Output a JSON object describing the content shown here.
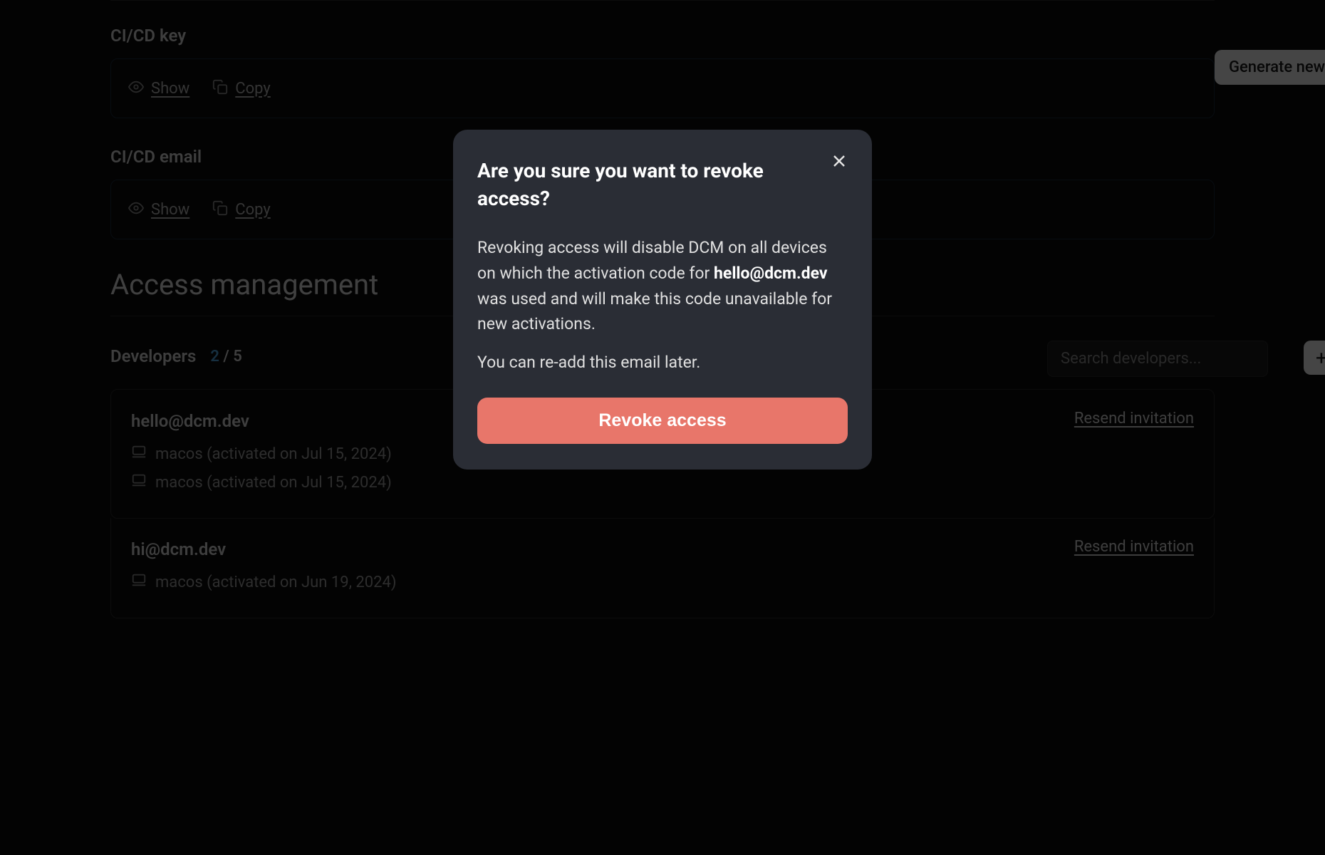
{
  "cicd_key": {
    "label": "CI/CD key",
    "show": "Show",
    "copy": "Copy",
    "generate_btn": "Generate new"
  },
  "cicd_email": {
    "label": "CI/CD email",
    "show": "Show",
    "copy": "Copy"
  },
  "section_heading": "Access management",
  "developers": {
    "title": "Developers",
    "used": "2",
    "sep": " / ",
    "total": "5",
    "search_placeholder": "Search developers...",
    "items": [
      {
        "email": "hello@dcm.dev",
        "resend": "Resend invitation",
        "devices": [
          "macos (activated on Jul 15, 2024)",
          "macos (activated on Jul 15, 2024)"
        ]
      },
      {
        "email": "hi@dcm.dev",
        "resend": "Resend invitation",
        "devices": [
          "macos (activated on Jun 19, 2024)"
        ]
      }
    ]
  },
  "modal": {
    "title": "Are you sure you want to revoke access?",
    "body_pre": "Revoking access will disable DCM on all devices on which the activation code for ",
    "body_email": "hello@dcm.dev",
    "body_post": " was used and will make this code unavailable for new activations.",
    "body_2": "You can re-add this email later.",
    "confirm": "Revoke access"
  }
}
